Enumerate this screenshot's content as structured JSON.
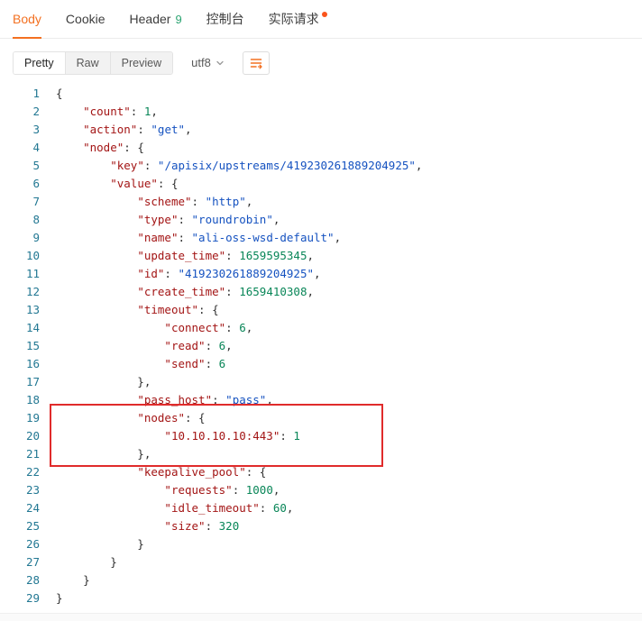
{
  "colors": {
    "accent": "#f37021",
    "badge-green": "#2ba471",
    "dot-red": "#fa541c",
    "tok-key": "#a31515",
    "tok-str": "#1552c0",
    "tok-num": "#098658",
    "tok-punct": "#303030",
    "lineno": "#237893",
    "annotation": "#e02b2b"
  },
  "tabs": [
    {
      "name": "body",
      "label": "Body",
      "active": true
    },
    {
      "name": "cookie",
      "label": "Cookie",
      "active": false
    },
    {
      "name": "header",
      "label": "Header",
      "badge": "9",
      "active": false
    },
    {
      "name": "console",
      "label": "控制台",
      "active": false
    },
    {
      "name": "actual-request",
      "label": "实际请求",
      "dot": true,
      "active": false
    }
  ],
  "toolbar": {
    "modes": [
      {
        "name": "pretty",
        "label": "Pretty",
        "active": true
      },
      {
        "name": "raw",
        "label": "Raw",
        "active": false
      },
      {
        "name": "preview",
        "label": "Preview",
        "active": false
      }
    ],
    "encoding": "utf8",
    "format_icon": "format-icon"
  },
  "code": {
    "highlight": {
      "from": 19,
      "to": 21
    },
    "lines": [
      {
        "n": 1,
        "t": [
          [
            "p",
            "{"
          ]
        ]
      },
      {
        "n": 2,
        "t": [
          [
            "p",
            "    "
          ],
          [
            "k",
            "\"count\""
          ],
          [
            "p",
            ": "
          ],
          [
            "n",
            "1"
          ],
          [
            "p",
            ","
          ]
        ]
      },
      {
        "n": 3,
        "t": [
          [
            "p",
            "    "
          ],
          [
            "k",
            "\"action\""
          ],
          [
            "p",
            ": "
          ],
          [
            "s",
            "\"get\""
          ],
          [
            "p",
            ","
          ]
        ]
      },
      {
        "n": 4,
        "t": [
          [
            "p",
            "    "
          ],
          [
            "k",
            "\"node\""
          ],
          [
            "p",
            ": {"
          ]
        ]
      },
      {
        "n": 5,
        "t": [
          [
            "p",
            "        "
          ],
          [
            "k",
            "\"key\""
          ],
          [
            "p",
            ": "
          ],
          [
            "s",
            "\"/apisix/upstreams/419230261889204925\""
          ],
          [
            "p",
            ","
          ]
        ]
      },
      {
        "n": 6,
        "t": [
          [
            "p",
            "        "
          ],
          [
            "k",
            "\"value\""
          ],
          [
            "p",
            ": {"
          ]
        ]
      },
      {
        "n": 7,
        "t": [
          [
            "p",
            "            "
          ],
          [
            "k",
            "\"scheme\""
          ],
          [
            "p",
            ": "
          ],
          [
            "s",
            "\"http\""
          ],
          [
            "p",
            ","
          ]
        ]
      },
      {
        "n": 8,
        "t": [
          [
            "p",
            "            "
          ],
          [
            "k",
            "\"type\""
          ],
          [
            "p",
            ": "
          ],
          [
            "s",
            "\"roundrobin\""
          ],
          [
            "p",
            ","
          ]
        ]
      },
      {
        "n": 9,
        "t": [
          [
            "p",
            "            "
          ],
          [
            "k",
            "\"name\""
          ],
          [
            "p",
            ": "
          ],
          [
            "s",
            "\"ali-oss-wsd-default\""
          ],
          [
            "p",
            ","
          ]
        ]
      },
      {
        "n": 10,
        "t": [
          [
            "p",
            "            "
          ],
          [
            "k",
            "\"update_time\""
          ],
          [
            "p",
            ": "
          ],
          [
            "n",
            "1659595345"
          ],
          [
            "p",
            ","
          ]
        ]
      },
      {
        "n": 11,
        "t": [
          [
            "p",
            "            "
          ],
          [
            "k",
            "\"id\""
          ],
          [
            "p",
            ": "
          ],
          [
            "s",
            "\"419230261889204925\""
          ],
          [
            "p",
            ","
          ]
        ]
      },
      {
        "n": 12,
        "t": [
          [
            "p",
            "            "
          ],
          [
            "k",
            "\"create_time\""
          ],
          [
            "p",
            ": "
          ],
          [
            "n",
            "1659410308"
          ],
          [
            "p",
            ","
          ]
        ]
      },
      {
        "n": 13,
        "t": [
          [
            "p",
            "            "
          ],
          [
            "k",
            "\"timeout\""
          ],
          [
            "p",
            ": {"
          ]
        ]
      },
      {
        "n": 14,
        "t": [
          [
            "p",
            "                "
          ],
          [
            "k",
            "\"connect\""
          ],
          [
            "p",
            ": "
          ],
          [
            "n",
            "6"
          ],
          [
            "p",
            ","
          ]
        ]
      },
      {
        "n": 15,
        "t": [
          [
            "p",
            "                "
          ],
          [
            "k",
            "\"read\""
          ],
          [
            "p",
            ": "
          ],
          [
            "n",
            "6"
          ],
          [
            "p",
            ","
          ]
        ]
      },
      {
        "n": 16,
        "t": [
          [
            "p",
            "                "
          ],
          [
            "k",
            "\"send\""
          ],
          [
            "p",
            ": "
          ],
          [
            "n",
            "6"
          ]
        ]
      },
      {
        "n": 17,
        "t": [
          [
            "p",
            "            },"
          ]
        ]
      },
      {
        "n": 18,
        "t": [
          [
            "p",
            "            "
          ],
          [
            "k",
            "\"pass_host\""
          ],
          [
            "p",
            ": "
          ],
          [
            "s",
            "\"pass\""
          ],
          [
            "p",
            ","
          ]
        ]
      },
      {
        "n": 19,
        "t": [
          [
            "p",
            "            "
          ],
          [
            "k",
            "\"nodes\""
          ],
          [
            "p",
            ": {"
          ]
        ]
      },
      {
        "n": 20,
        "t": [
          [
            "p",
            "                "
          ],
          [
            "k",
            "\"10.10.10.10:443\""
          ],
          [
            "p",
            ": "
          ],
          [
            "n",
            "1"
          ]
        ]
      },
      {
        "n": 21,
        "t": [
          [
            "p",
            "            },"
          ]
        ]
      },
      {
        "n": 22,
        "t": [
          [
            "p",
            "            "
          ],
          [
            "k",
            "\"keepalive_pool\""
          ],
          [
            "p",
            ": {"
          ]
        ]
      },
      {
        "n": 23,
        "t": [
          [
            "p",
            "                "
          ],
          [
            "k",
            "\"requests\""
          ],
          [
            "p",
            ": "
          ],
          [
            "n",
            "1000"
          ],
          [
            "p",
            ","
          ]
        ]
      },
      {
        "n": 24,
        "t": [
          [
            "p",
            "                "
          ],
          [
            "k",
            "\"idle_timeout\""
          ],
          [
            "p",
            ": "
          ],
          [
            "n",
            "60"
          ],
          [
            "p",
            ","
          ]
        ]
      },
      {
        "n": 25,
        "t": [
          [
            "p",
            "                "
          ],
          [
            "k",
            "\"size\""
          ],
          [
            "p",
            ": "
          ],
          [
            "n",
            "320"
          ]
        ]
      },
      {
        "n": 26,
        "t": [
          [
            "p",
            "            }"
          ]
        ]
      },
      {
        "n": 27,
        "t": [
          [
            "p",
            "        }"
          ]
        ]
      },
      {
        "n": 28,
        "t": [
          [
            "p",
            "    }"
          ]
        ]
      },
      {
        "n": 29,
        "t": [
          [
            "p",
            "}"
          ]
        ]
      }
    ]
  }
}
